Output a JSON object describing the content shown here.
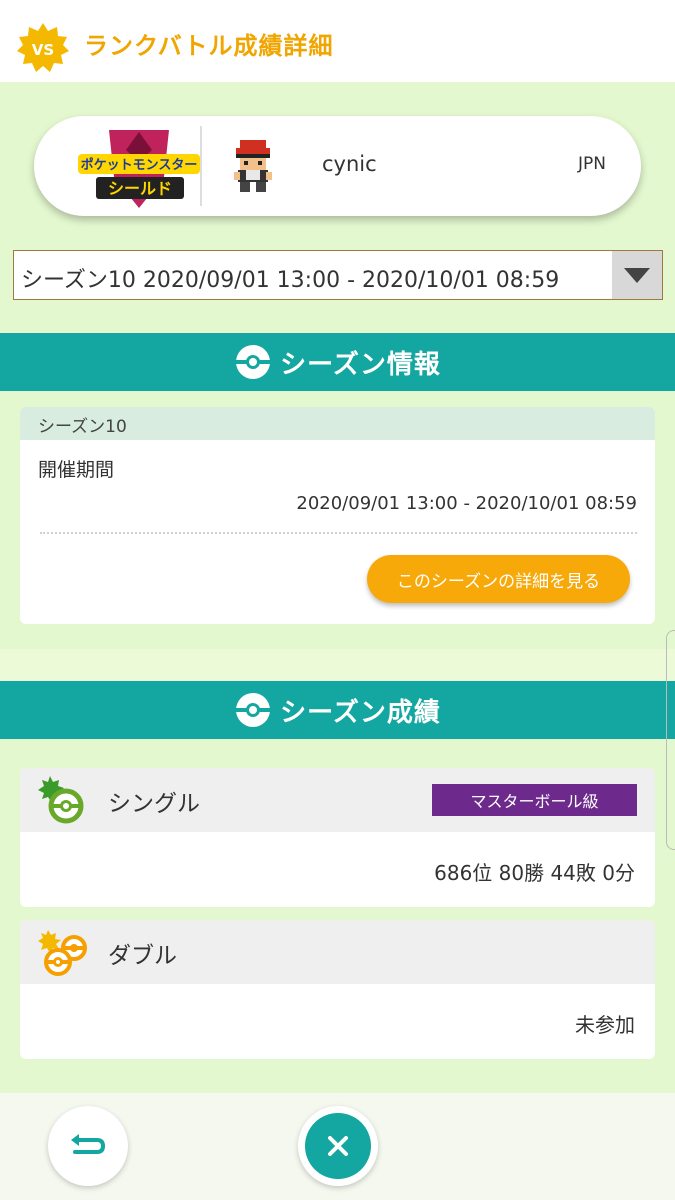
{
  "header": {
    "badge_text": "VS",
    "title": "ランクバトル成績詳細",
    "accent_color": "#f0a500"
  },
  "player": {
    "game_logo_top": "ポケットモンスター",
    "game_logo_bottom": "シールド",
    "name": "cynic",
    "region": "JPN"
  },
  "season_select": {
    "selected": "シーズン10 2020/09/01 13:00 - 2020/10/01 08:59"
  },
  "season_info": {
    "section_title": "シーズン情報",
    "card_title": "シーズン10",
    "period_label": "開催期間",
    "period_value": "2020/09/01 13:00 - 2020/10/01 08:59",
    "detail_button": "このシーズンの詳細を見る"
  },
  "season_results": {
    "section_title": "シーズン成績",
    "single": {
      "label": "シングル",
      "rank_badge": "マスターボール級",
      "value": "686位 80勝 44敗 0分"
    },
    "double": {
      "label": "ダブル",
      "value": "未参加"
    }
  },
  "colors": {
    "teal": "#14a6a0",
    "orange": "#f7a90a",
    "purple": "#6d2a8c",
    "light_green": "#e4f8cf"
  },
  "icons": {
    "header": "vs-badge-icon",
    "section": "pokeball-icon",
    "single": "single-battle-icon",
    "double": "double-battle-icon",
    "back": "back-arrow-icon",
    "close": "close-icon"
  }
}
